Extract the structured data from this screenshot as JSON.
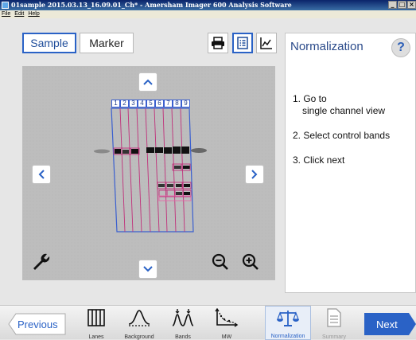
{
  "window": {
    "title": "01sample 2015.03.13_16.09.01_Ch* - Amersham Imager 600 Analysis Software",
    "buttons": {
      "minimize": "_",
      "maximize": "□",
      "close": "×"
    }
  },
  "menu": {
    "file": "File",
    "edit": "Edit",
    "help": "Help"
  },
  "view_tabs": {
    "sample": "Sample",
    "marker": "Marker"
  },
  "toolbar_icons": [
    "printer-icon",
    "list-icon",
    "chart-icon"
  ],
  "image": {
    "lane_numbers": [
      "1",
      "2",
      "3",
      "4",
      "5",
      "6",
      "7",
      "8",
      "9"
    ]
  },
  "panel": {
    "title": "Normalization",
    "help_label": "?",
    "steps": [
      {
        "line1": "1. Go to",
        "line2": "single channel view"
      },
      {
        "line1": "2. Select control bands"
      },
      {
        "line1": "3. Click next"
      }
    ]
  },
  "workflow": {
    "previous_label": "Previous",
    "next_label": "Next",
    "steps": [
      {
        "label": "Lanes",
        "icon": "lanes-icon"
      },
      {
        "label": "Background",
        "icon": "background-icon"
      },
      {
        "label": "Bands",
        "icon": "bands-icon"
      },
      {
        "label": "MW",
        "icon": "mw-icon"
      },
      {
        "label": "Normalization",
        "icon": "scale-icon"
      },
      {
        "label": "Summary",
        "icon": "document-icon"
      }
    ]
  },
  "colors": {
    "accent": "#2a62c6",
    "lanes": "#c0307a",
    "grid_border": "#3a5fcf"
  }
}
